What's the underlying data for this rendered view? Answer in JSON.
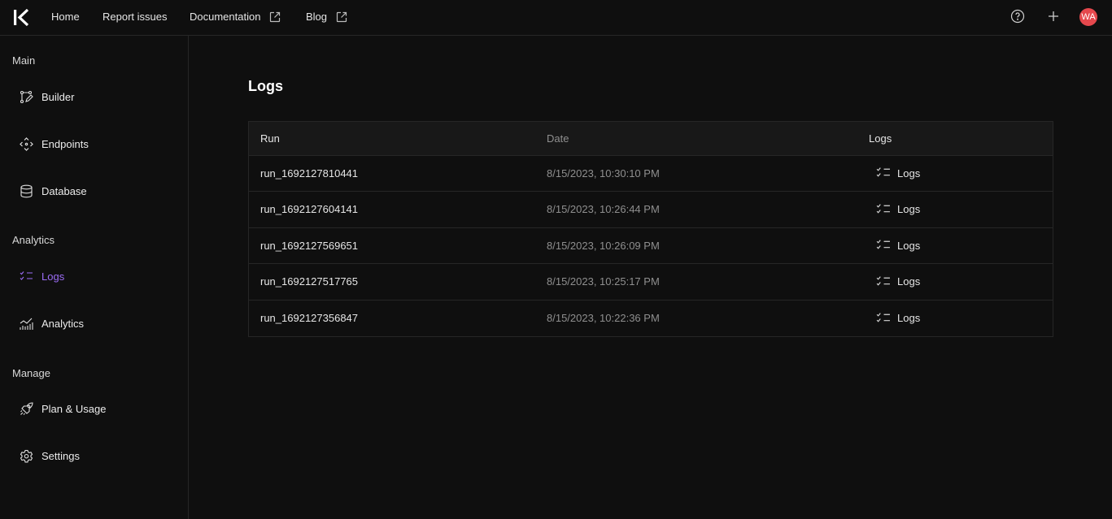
{
  "topnav": {
    "links": [
      {
        "label": "Home"
      },
      {
        "label": "Report issues"
      },
      {
        "label": "Documentation",
        "icon": "external-link-icon"
      },
      {
        "label": "Blog",
        "icon": "external-link-icon"
      }
    ],
    "icons": [
      "help-circle-icon",
      "plus-icon"
    ],
    "avatar_initials": "WA",
    "avatar_color": "#e5484d"
  },
  "sidebar": {
    "sections": [
      {
        "title": "Main",
        "items": [
          {
            "label": "Builder",
            "icon": "builder-icon"
          },
          {
            "label": "Endpoints",
            "icon": "endpoints-icon"
          },
          {
            "label": "Database",
            "icon": "database-icon"
          }
        ]
      },
      {
        "title": "Analytics",
        "items": [
          {
            "label": "Logs",
            "icon": "list-checks-icon",
            "active": true
          },
          {
            "label": "Analytics",
            "icon": "chart-line-icon"
          }
        ]
      },
      {
        "title": "Manage",
        "items": [
          {
            "label": "Plan & Usage",
            "icon": "rocket-icon"
          },
          {
            "label": "Settings",
            "icon": "gear-icon"
          }
        ]
      }
    ],
    "accent_color": "#9b6cf5"
  },
  "main": {
    "title": "Logs",
    "table": {
      "headers": [
        "Run",
        "Date",
        "Logs"
      ],
      "rows": [
        {
          "run": "run_1692127810441",
          "date": "8/15/2023, 10:30:10 PM",
          "logs": "Logs"
        },
        {
          "run": "run_1692127604141",
          "date": "8/15/2023, 10:26:44 PM",
          "logs": "Logs"
        },
        {
          "run": "run_1692127569651",
          "date": "8/15/2023, 10:26:09 PM",
          "logs": "Logs"
        },
        {
          "run": "run_1692127517765",
          "date": "8/15/2023, 10:25:17 PM",
          "logs": "Logs"
        },
        {
          "run": "run_1692127356847",
          "date": "8/15/2023, 10:22:36 PM",
          "logs": "Logs"
        }
      ]
    }
  }
}
